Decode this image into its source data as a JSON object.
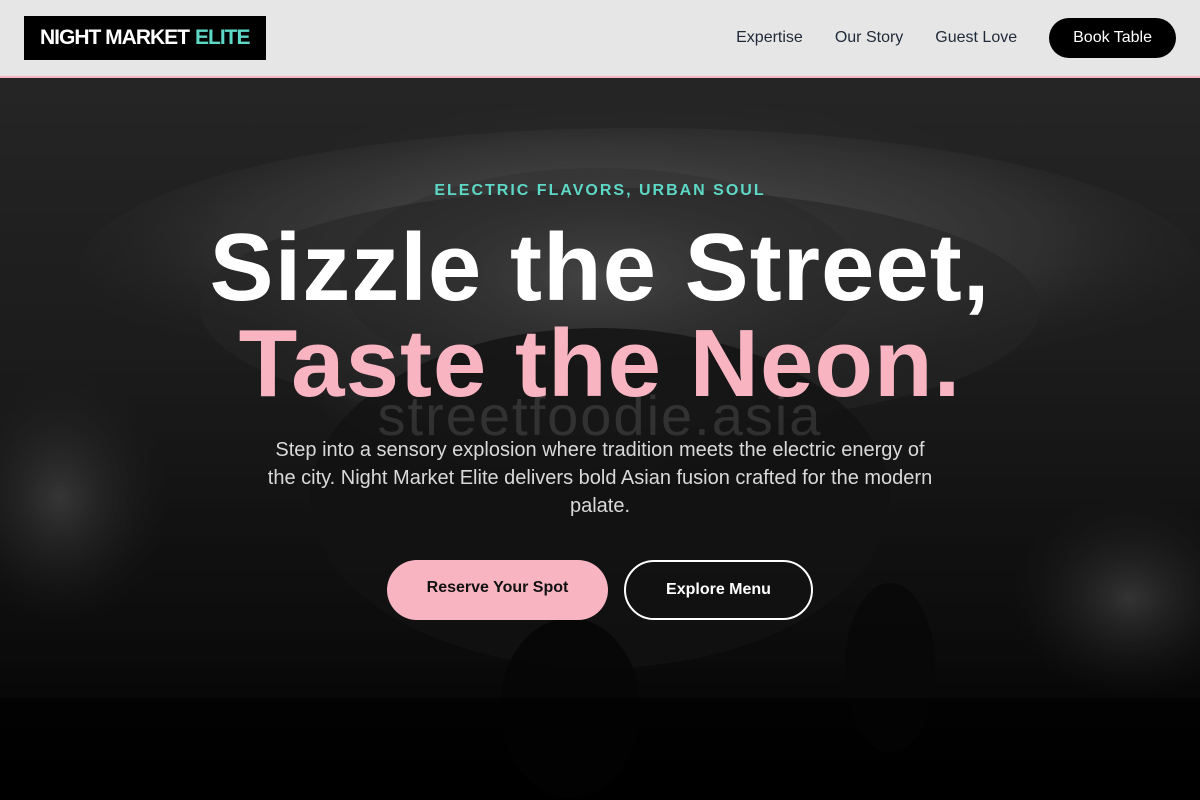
{
  "header": {
    "logo_main": "NIGHT MARKET",
    "logo_accent": "ELITE",
    "nav": [
      "Expertise",
      "Our Story",
      "Guest Love"
    ],
    "book_label": "Book Table"
  },
  "hero": {
    "eyebrow": "ELECTRIC FLAVORS, URBAN SOUL",
    "title_line1": "Sizzle the Street,",
    "title_line2": "Taste the Neon.",
    "watermark": "streetfoodie.asia",
    "subtitle": "Step into a sensory explosion where tradition meets the electric energy of the city. Night Market Elite delivers bold Asian fusion crafted for the modern palate.",
    "primary_cta": "Reserve Your Spot",
    "secondary_cta": "Explore Menu"
  },
  "colors": {
    "accent_teal": "#5ed8c6",
    "accent_pink": "#f9b4c2",
    "header_bg": "#e6e6e6",
    "header_border": "#f7b5c3"
  }
}
